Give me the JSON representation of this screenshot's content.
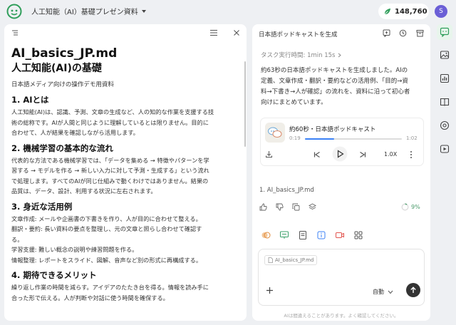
{
  "app": {
    "title": "人工知能（AI）基礎プレゼン資料",
    "credits": "148,760",
    "avatar_initial": "S",
    "accent_color": "#2f9e5a"
  },
  "document": {
    "filename": "AI_basics_JP.md",
    "title": "人工知能(AI)の基礎",
    "subtitle": "日本語メディア向けの操作デモ用資料",
    "sections": [
      {
        "heading": "1. AIとは",
        "lines": [
          "人工知能(AI)は、認識、予測、文章の生成など、人の知的な作業を支援する技",
          "術の総称です。AIが人間と同じように理解しているとは限りません。目的に",
          "合わせて、人が結果を確認しながら活用します。"
        ]
      },
      {
        "heading": "2. 機械学習の基本的な流れ",
        "lines": [
          "代表的な方法である機械学習では、「データを集める → 特徴やパターンを学",
          "習する → モデルを作る → 新しい入力に対して予測・生成する」という流れ",
          "で処理します。すべてのAIが同じ仕組みで動くわけではありません。結果の",
          "品質は、データ、設計、利用する状況に左右されます。"
        ]
      },
      {
        "heading": "3. 身近な活用例",
        "lines": [
          "文章作成: メールや企画書の下書きを作り、人が目的に合わせて整える。",
          "翻訳・要約: 長い資料の要点を整理し、元の文章と照らし合わせて確認す",
          "る。",
          "学習支援: 難しい概念の説明や練習問題を作る。",
          "情報整理: レポートをスライド、図解、音声など別の形式に再構成する。"
        ]
      },
      {
        "heading": "4. 期待できるメリット",
        "lines": [
          "繰り返し作業の時間を減らす。アイデアのたたき台を得る。情報を読み手に",
          "合った形で伝える。人が判断や対話に使う時間を確保する。"
        ]
      }
    ]
  },
  "chat": {
    "title": "日本語ポッドキャストを生成",
    "task_time": "タスク実行時間: 1min 15s",
    "message_lines": [
      "約63秒の日本語ポッドキャストを生成しました。AIの",
      "定義、文章作成・翻訳・要約などの活用例、「目的→資",
      "料→下書き→人が確認」の流れを、資料に沿って初心者",
      "向けにまとめています。"
    ],
    "audio": {
      "title": "約60秒・日本語ポッドキャスト",
      "current_time": "0:19",
      "duration": "1:02",
      "progress": 0.3,
      "speed": "1.0X"
    },
    "source_link": "1. AI_basics_JP.md",
    "progress_percent": "9%",
    "input": {
      "attached_file": "AI_basics_JP.md",
      "mode": "自動"
    },
    "disclaimer": "AIは間違えることがあります。よく確認してください。"
  }
}
